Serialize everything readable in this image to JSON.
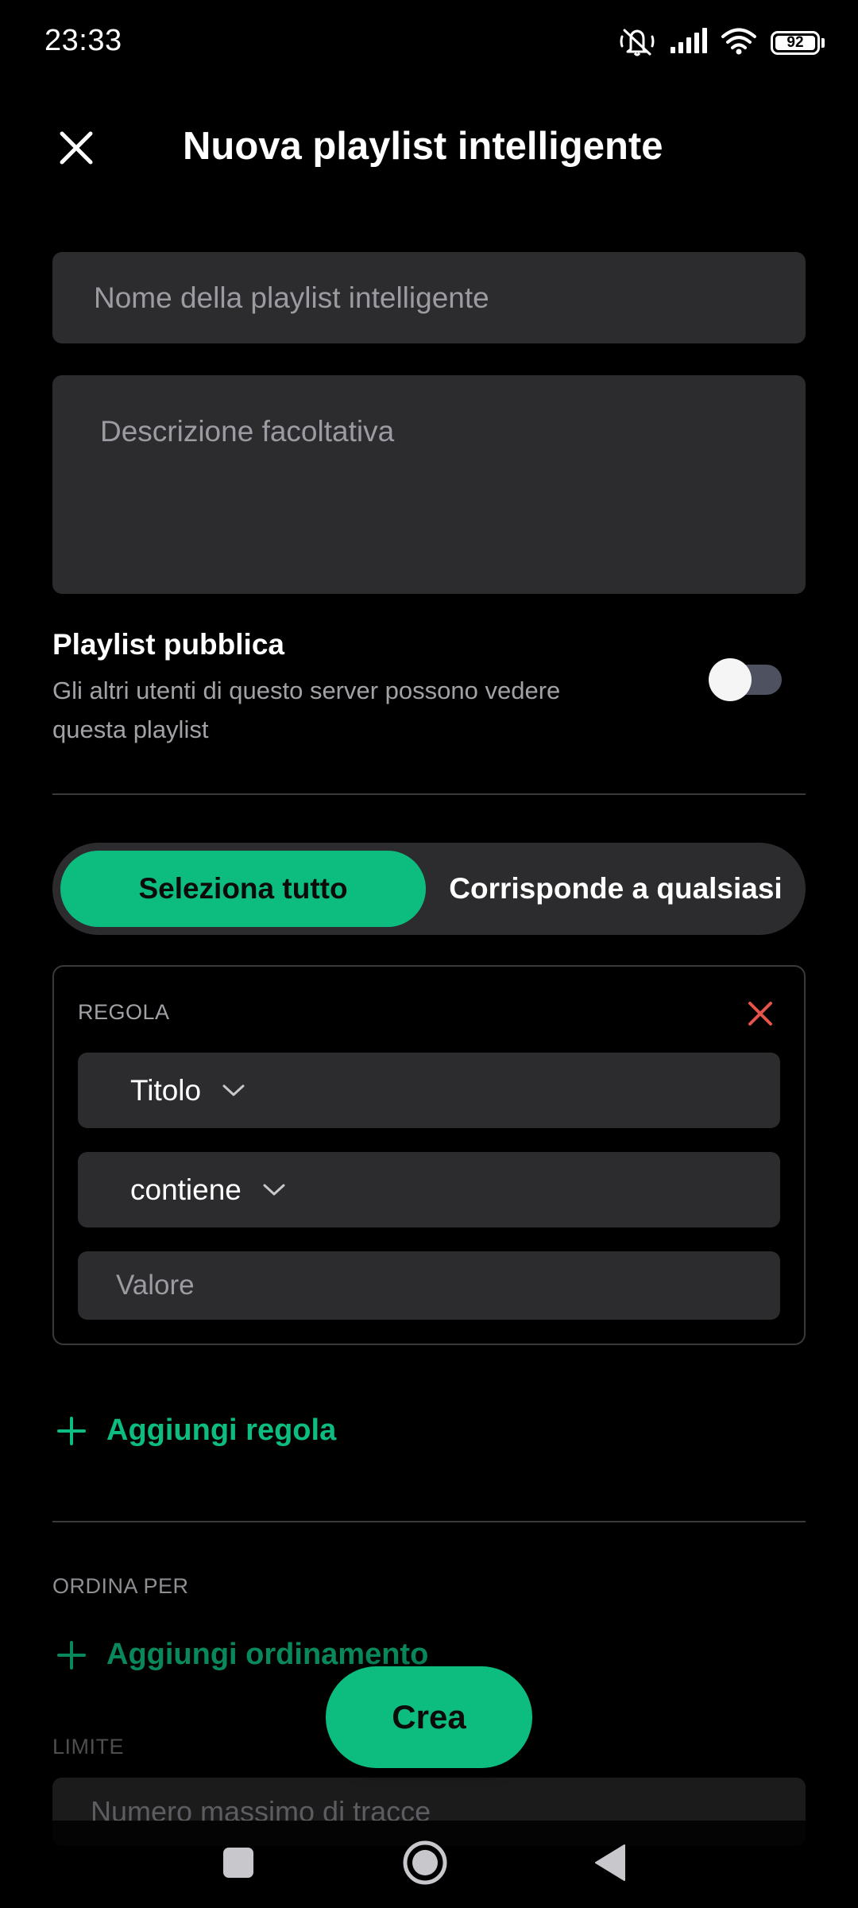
{
  "status_bar": {
    "time": "23:33",
    "battery": "92",
    "icons": [
      "mute-icon",
      "signal-icon",
      "wifi-icon",
      "battery-icon"
    ]
  },
  "header": {
    "title": "Nuova playlist intelligente",
    "close_icon": "close-icon"
  },
  "form": {
    "name_placeholder": "Nome della playlist intelligente",
    "description_placeholder": "Descrizione facoltativa",
    "public": {
      "title": "Playlist pubblica",
      "description": "Gli altri utenti di questo server possono vedere questa playlist",
      "enabled": false
    }
  },
  "match_mode": {
    "options": [
      "Seleziona tutto",
      "Corrisponde a qualsiasi"
    ],
    "selected": "Seleziona tutto"
  },
  "rules": [
    {
      "label": "REGOLA",
      "field": "Titolo",
      "operator": "contiene",
      "value_placeholder": "Valore"
    }
  ],
  "add_rule_label": "Aggiungi regola",
  "sort": {
    "section_label": "ORDINA PER",
    "add_label": "Aggiungi ordinamento"
  },
  "limit": {
    "section_label": "LIMITE",
    "placeholder": "Numero massimo di tracce"
  },
  "fab": {
    "label": "Crea"
  },
  "colors": {
    "accent": "#0dbd7f",
    "background": "#000000",
    "surface": "#2c2c2e",
    "danger": "#e5534b"
  }
}
